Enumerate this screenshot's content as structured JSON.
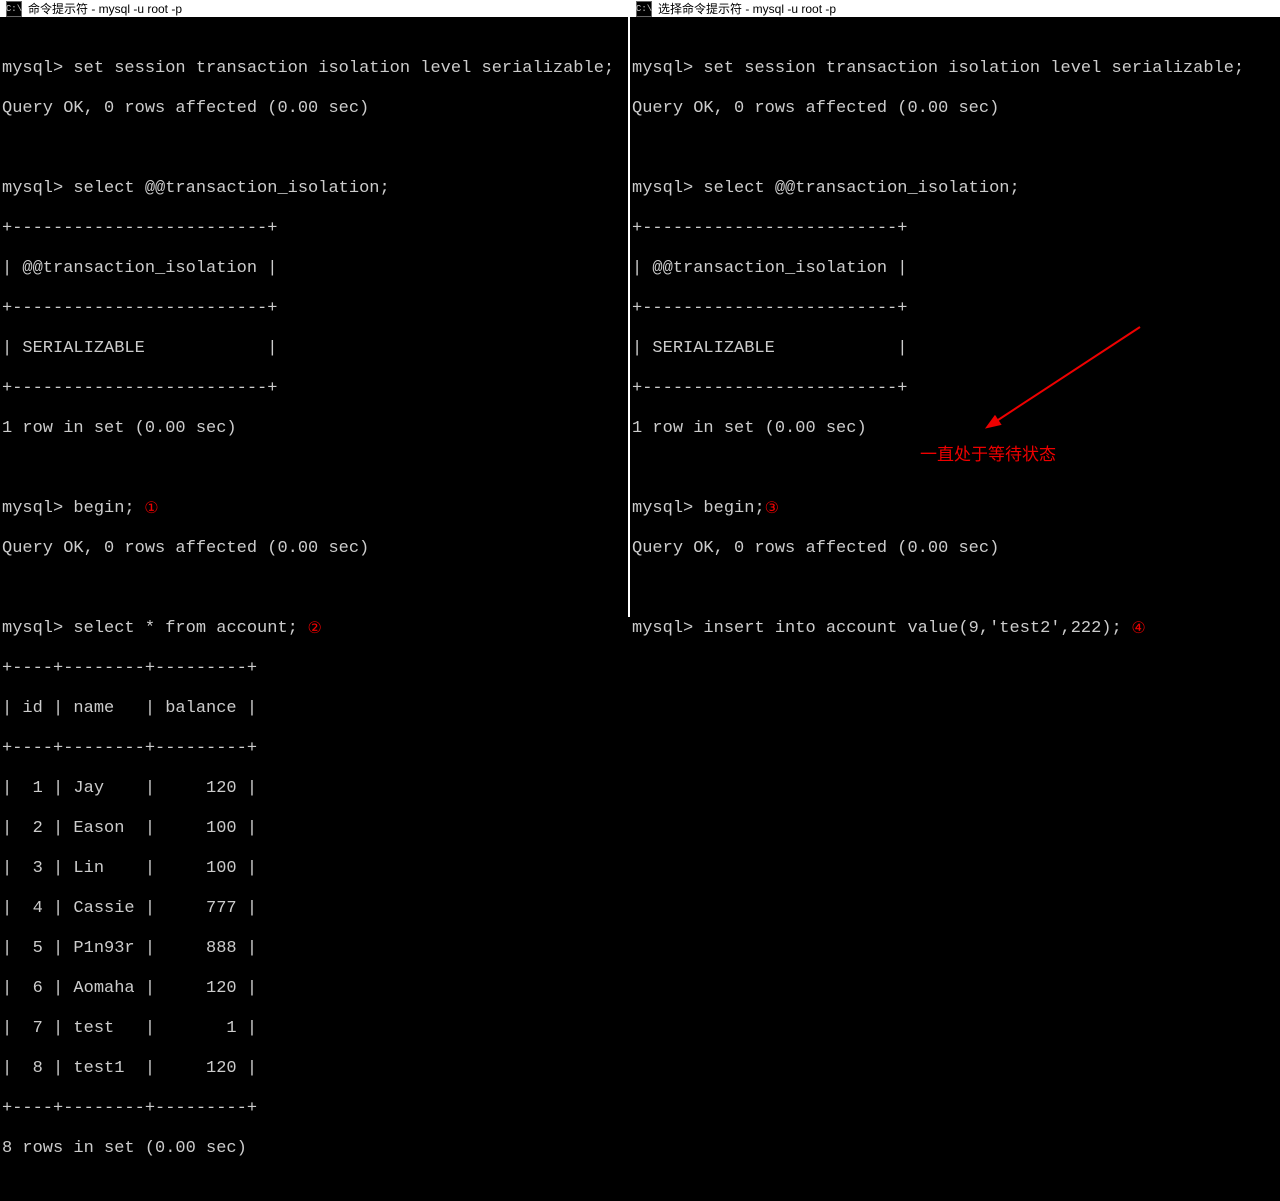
{
  "left": {
    "title": "命令提示符 - mysql  -u root -p",
    "prompt": "mysql>",
    "cmd_set": " set session transaction isolation level serializable;",
    "query_ok": "Query OK, 0 rows affected (0.00 sec)",
    "cmd_select_iso": " select @@transaction_isolation;",
    "sep_iso": "+-------------------------+",
    "hdr_iso": "| @@transaction_isolation |",
    "val_iso": "| SERIALIZABLE            |",
    "one_row": "1 row in set (0.00 sec)",
    "cmd_begin": " begin;",
    "cmd_select_acct": " select * from account;",
    "sep_acct": "+----+--------+---------+",
    "hdr_acct": "| id | name   | balance |",
    "rows": [
      "|  1 | Jay    |     120 |",
      "|  2 | Eason  |     100 |",
      "|  3 | Lin    |     100 |",
      "|  4 | Cassie |     777 |",
      "|  5 | P1n93r |     888 |",
      "|  6 | Aomaha |     120 |",
      "|  7 | test   |       1 |",
      "|  8 | test1  |     120 |"
    ],
    "eight_rows": "8 rows in set (0.00 sec)",
    "marker1": " ①",
    "marker2": " ②"
  },
  "right": {
    "title": "选择命令提示符 - mysql  -u root -p",
    "prompt": "mysql>",
    "cmd_set": " set session transaction isolation level serializable;",
    "query_ok": "Query OK, 0 rows affected (0.00 sec)",
    "cmd_select_iso": " select @@transaction_isolation;",
    "sep_iso": "+-------------------------+",
    "hdr_iso": "| @@transaction_isolation |",
    "val_iso": "| SERIALIZABLE            |",
    "one_row": "1 row in set (0.00 sec)",
    "cmd_begin": " begin;",
    "cmd_insert": " insert into account value(9,'test2',222);",
    "marker3": "③",
    "marker4": " ④",
    "annotation": "一直处于等待状态"
  }
}
